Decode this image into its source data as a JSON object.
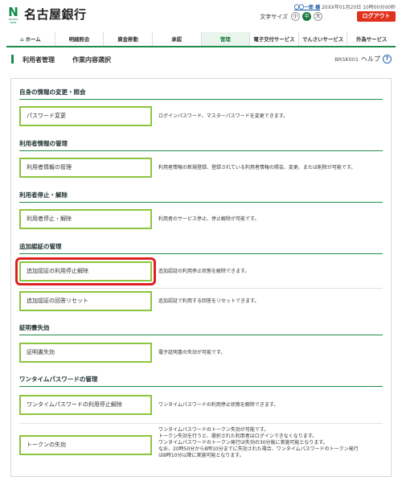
{
  "header": {
    "bank_name": "名古屋銀行",
    "logo_sub": "NAGOYA BANK",
    "user_name": "〇〇一郎 様",
    "timestamp": "20XX年01月20日 10時00分00秒",
    "font_size_label": "文字サイズ",
    "font_sizes": [
      "小",
      "中",
      "大"
    ],
    "font_size_selected": "中",
    "logout_label": "ログアウト"
  },
  "nav": {
    "items": [
      {
        "label": "ホーム",
        "icon": "home-icon"
      },
      {
        "label": "明細照会"
      },
      {
        "label": "資金移動"
      },
      {
        "label": "承認"
      },
      {
        "label": "管理",
        "active": true
      },
      {
        "label": "電子交付サービス"
      },
      {
        "label": "でんさいサービス"
      },
      {
        "label": "外為サービス"
      }
    ]
  },
  "page": {
    "category": "利用者管理",
    "title": "作業内容選択",
    "screen_id": "BRSK001",
    "help_label": "ヘルプ"
  },
  "sections": [
    {
      "heading": "自身の情報の変更・照会",
      "rows": [
        {
          "button": "パスワード変更",
          "desc": "ログインパスワード、マスターパスワードを変更できます。"
        }
      ]
    },
    {
      "heading": "利用者情報の管理",
      "rows": [
        {
          "button": "利用者情報の管理",
          "desc": "利用者情報の新規登録、登録されている利用者情報の照会、変更、または削除が可能です。"
        }
      ]
    },
    {
      "heading": "利用者停止・解除",
      "rows": [
        {
          "button": "利用者停止・解除",
          "desc": "利用者のサービス停止、停止解除が可能です。"
        }
      ]
    },
    {
      "heading": "追加認証の管理",
      "rows": [
        {
          "button": "追加認証の利用停止解除",
          "desc": "追加認証の利用停止状態を解除できます。",
          "highlight": true
        },
        {
          "button": "追加認証の回答リセット",
          "desc": "追加認証で利用する回答をリセットできます。"
        }
      ]
    },
    {
      "heading": "証明書失効",
      "rows": [
        {
          "button": "証明書失効",
          "desc": "電子証明書の失効が可能です。"
        }
      ]
    },
    {
      "heading": "ワンタイムパスワードの管理",
      "rows": [
        {
          "button": "ワンタイムパスワードの利用停止解除",
          "desc": "ワンタイムパスワードの利用停止状態を解除できます。"
        },
        {
          "button": "トークンの失効",
          "desc_lines": [
            "ワンタイムパスワードのトークン失効が可能です。",
            "トークン失効を行うと、選択された利用者はログインできなくなります。",
            "ワンタイムパスワードのトークン発行は失効の30分後に実施可能となります。",
            "なお、20時50分から8時10分までに失効された場合、ワンタイムパスワードのトークン発行",
            "は8時10分以降に実施可能となります。"
          ]
        }
      ]
    }
  ]
}
